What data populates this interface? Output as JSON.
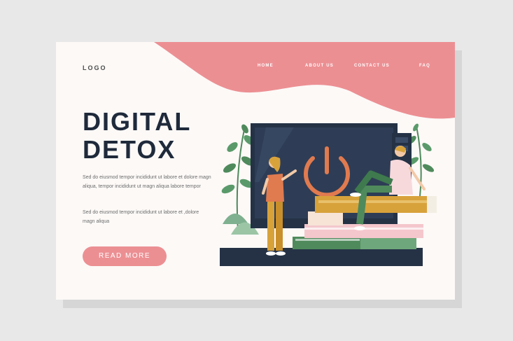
{
  "header": {
    "logo_text": "LOGO",
    "nav_items": [
      {
        "label": "HOME"
      },
      {
        "label": "ABOUT US"
      },
      {
        "label": "CONTACT US"
      },
      {
        "label": "FAQ"
      }
    ]
  },
  "hero": {
    "title_line1": "DIGITAL",
    "title_line2": "DETOX",
    "paragraph1": "Sed do eiusmod tempor incididunt ut labore et dolore magn aliqua, tempor incididunt ut magn aliqua labore tempor",
    "paragraph2": "Sed do eiusmod tempor incididunt ut labore et ,dolore magn aliqua",
    "cta_label": "READ MORE"
  },
  "illustration": {
    "icons": [
      "power-icon"
    ],
    "description_items": [
      "monitor",
      "books",
      "plants",
      "person-standing",
      "person-sitting"
    ]
  },
  "colors": {
    "accent": "#ec8f93",
    "dark": "#1f2a3b",
    "background": "#fcf9f7",
    "mustard": "#d8a23b",
    "green": "#4f8a5c"
  }
}
